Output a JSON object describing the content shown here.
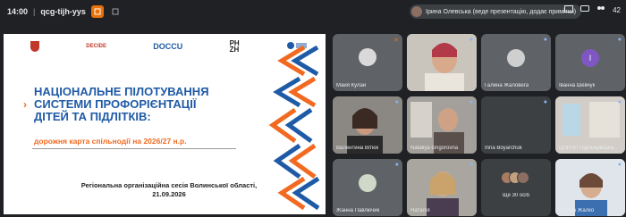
{
  "topbar": {
    "time": "14:00",
    "separator": "|",
    "meeting_code": "qcg-tijh-yys",
    "presenter_text": "Ірина Олевська (веде презентацію, додає примітки)",
    "participant_count": "42"
  },
  "slide": {
    "title_lines": [
      "НАЦІОНАЛЬНЕ ПІЛОТУВАННЯ",
      "СИСТЕМИ ПРОФОРІЄНТАЦІЇ",
      "ДІТЕЙ ТА ПІДЛІТКІВ:"
    ],
    "arrow_glyph": "›",
    "subtitle": "дорожня карта спільнодії на 2026/27 н.р.",
    "session_line1": "Регіональна організаційна сесія  Волинської області,",
    "session_line2": "21.09.2026",
    "logos": {
      "decide": "DECIDE",
      "doccu": "DOCCU",
      "phzh_top": "PH",
      "phzh_bottom": "ZH"
    }
  },
  "participants": [
    {
      "name": "Майя Кулай",
      "mic": "off"
    },
    {
      "name": "",
      "mic": "on"
    },
    {
      "name": "Галина Жаловега",
      "mic": "on"
    },
    {
      "name": "Іванна Шевчук",
      "mic": "on",
      "initial": "І"
    },
    {
      "name": "Валентина Вітюк",
      "mic": "on"
    },
    {
      "name": "Nataliya Grigorovna",
      "mic": "on"
    },
    {
      "name": "Inna Boyarchuk",
      "mic": "on"
    },
    {
      "name": "ЦПРПП Підгайцівська...",
      "mic": "on"
    },
    {
      "name": "Жанна Павлючик",
      "mic": "on"
    },
    {
      "name": "Наталія",
      "mic": "on"
    },
    {
      "name": "Ще 30 осіб",
      "mic": "none"
    },
    {
      "name": "Тетяна Жалко",
      "mic": "on"
    }
  ],
  "colors": {
    "brand_blue": "#1f5aa6",
    "brand_orange": "#f26a21",
    "background": "#202124"
  }
}
